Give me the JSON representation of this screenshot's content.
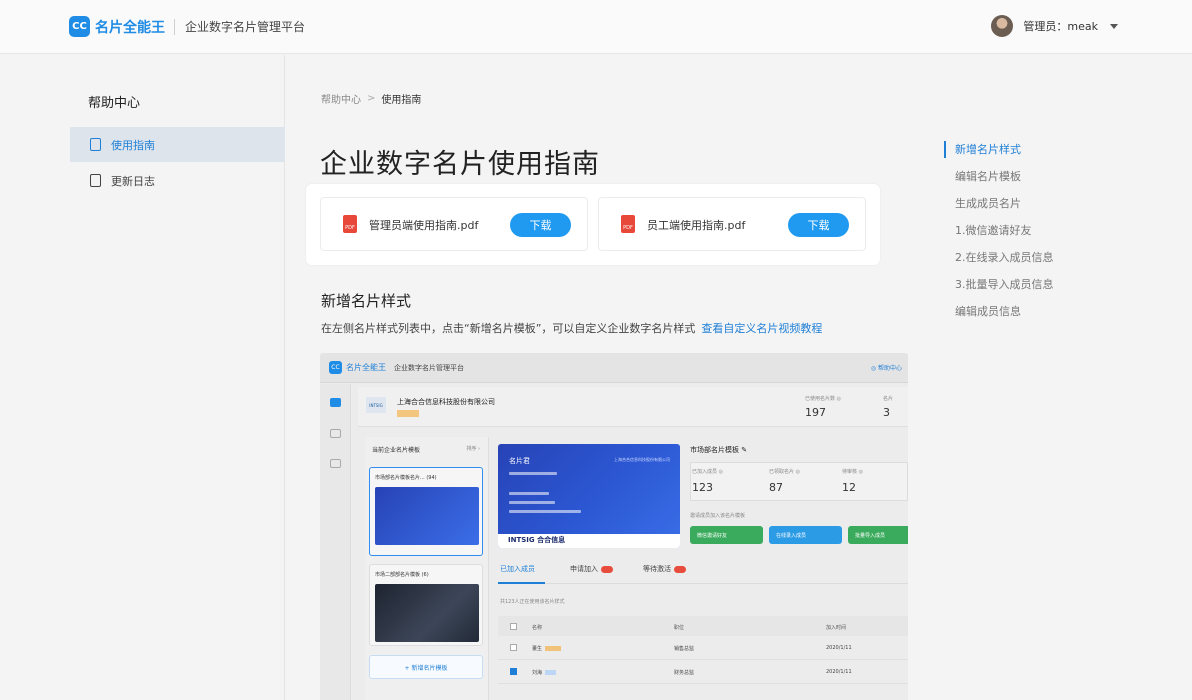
{
  "header": {
    "logo_mark": "CC",
    "logo_name": "名片全能王",
    "logo_sub": "企业数字名片管理平台",
    "user_label": "管理员：meak"
  },
  "sidebar": {
    "title": "帮助中心",
    "items": [
      {
        "label": "使用指南",
        "active": true
      },
      {
        "label": "更新日志",
        "active": false
      }
    ]
  },
  "breadcrumb": {
    "parent": "帮助中心",
    "sep": ">",
    "current": "使用指南"
  },
  "page_title": "企业数字名片使用指南",
  "downloads": [
    {
      "file": "管理员端使用指南.pdf",
      "button": "下载",
      "icon": "PDF"
    },
    {
      "file": "员工端使用指南.pdf",
      "button": "下载",
      "icon": "PDF"
    }
  ],
  "section": {
    "title": "新增名片样式",
    "desc": "在左侧名片样式列表中，点击“新增名片模板”，可以自定义企业数字名片样式",
    "link": "查看自定义名片视频教程"
  },
  "toc": [
    {
      "label": "新增名片样式",
      "active": true
    },
    {
      "label": "编辑名片模板",
      "active": false
    },
    {
      "label": "生成成员名片",
      "active": false
    },
    {
      "label": "1.微信邀请好友",
      "active": false
    },
    {
      "label": "2.在线录入成员信息",
      "active": false
    },
    {
      "label": "3.批量导入成员信息",
      "active": false
    },
    {
      "label": "编辑成员信息",
      "active": false
    }
  ],
  "screenshot": {
    "logo_mark": "CC",
    "app_name": "名片全能王",
    "app_sub": "企业数字名片管理平台",
    "help": "◎ 帮助中心",
    "company": "上海合合信息科技股份有限公司",
    "company_logo": "INTSIG",
    "stats": [
      {
        "label": "已使用名片数 ◎",
        "value": "197"
      },
      {
        "label": "名片",
        "value": "3"
      }
    ],
    "tpl_panel_title": "当前企业名片模板",
    "tpl_panel_more": "排序 ›",
    "templates": [
      "市场部名片模板名片...  (94)",
      "市场二部部名片模板 (6)"
    ],
    "add_template": "+ 新增名片模板",
    "card": {
      "name": "名片君",
      "company": "上海合合信息科技股份有限公司",
      "brand": "INTSIG 合合信息"
    },
    "tpl_info_title": "市场部名片模板 ✎",
    "tpl_stats": [
      {
        "label": "已加入成员 ◎",
        "value": "123"
      },
      {
        "label": "已领取名片 ◎",
        "value": "87"
      },
      {
        "label": "待审核 ◎",
        "value": "12"
      }
    ],
    "tpl_hint": "邀请成员加入该名片模板",
    "tpl_buttons": [
      "微信邀请好友",
      "在线录入成员",
      "批量导入成员"
    ],
    "tabs": [
      "已加入成员",
      "申请加入",
      "等待激活"
    ],
    "note": "共123人正在使用该名片样式",
    "table_head": [
      "名称",
      "职位",
      "加入时间"
    ],
    "rows": [
      {
        "name": "董生",
        "tag": "管理员",
        "role": "销售总监",
        "date": "2020/1/11"
      },
      {
        "name": "刘海",
        "tag": "成员",
        "role": "财务总监",
        "date": "2020/1/11"
      }
    ]
  }
}
